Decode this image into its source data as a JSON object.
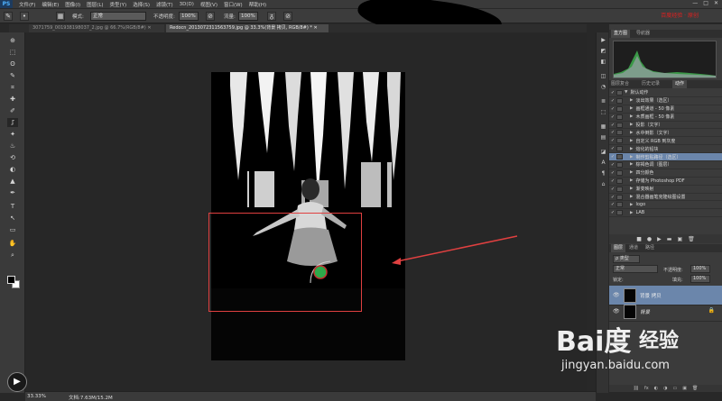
{
  "app": {
    "logo": "PS"
  },
  "menu": [
    "文件(F)",
    "编辑(E)",
    "图像(I)",
    "图层(L)",
    "类型(Y)",
    "选择(S)",
    "滤镜(T)",
    "3D(D)",
    "视图(V)",
    "窗口(W)",
    "帮助(H)"
  ],
  "window_controls": [
    "—",
    "□",
    "✕"
  ],
  "options": {
    "mode_label": "模式:",
    "mode_value": "正常",
    "opacity_label": "不透明度:",
    "opacity_value": "100%",
    "flow_label": "流量:",
    "flow_value": "100%",
    "annotation": "百度经验 · 原创"
  },
  "tabs": [
    {
      "label": "3071759_001938198037_2.jpg @ 66.7%(RGB/8#) ✕",
      "active": false
    },
    {
      "label": "Redocn_2013072311563759.jpg @ 33.3%(背景 拷贝, RGB/8#) * ✕",
      "active": true
    }
  ],
  "tools": [
    "⊕",
    "⬚",
    "ʘ",
    "✎",
    "⌗",
    "✚",
    "✐",
    "⎎",
    "✦",
    "♨",
    "⟲",
    "◐",
    "▲",
    "✒",
    "T",
    "↖",
    "▭",
    "✋",
    "⌕"
  ],
  "dock": [
    "▶",
    "◩",
    "◧",
    "◫",
    "◔",
    "≣",
    "⬚",
    "▦",
    "▤",
    "◪",
    "A",
    "¶",
    "⌂"
  ],
  "histogram_panel": {
    "tabs": [
      "直方图",
      "导航器"
    ]
  },
  "actions_panel": {
    "tabs": [
      "图层复合",
      "历史记录",
      "动作"
    ],
    "items": [
      {
        "label": "默认动作",
        "selected": false
      },
      {
        "label": "淡出效果（选区）",
        "selected": false
      },
      {
        "label": "画框通道 - 50 像素",
        "selected": false
      },
      {
        "label": "木质画框 - 50 像素",
        "selected": false
      },
      {
        "label": "投影（文字）",
        "selected": false
      },
      {
        "label": "水中倒影（文字）",
        "selected": false
      },
      {
        "label": "自定义 RGB 到灰度",
        "selected": false
      },
      {
        "label": "熔化的铅块",
        "selected": false
      },
      {
        "label": "制作剪贴路径（选区）",
        "selected": true
      },
      {
        "label": "棕褐色调（图层）",
        "selected": false
      },
      {
        "label": "四分颜色",
        "selected": false
      },
      {
        "label": "存储为 Photoshop PDF",
        "selected": false
      },
      {
        "label": "渐变映射",
        "selected": false
      },
      {
        "label": "混合器画笔克隆绘图设置",
        "selected": false
      },
      {
        "label": "logo",
        "selected": false
      },
      {
        "label": "LAB",
        "selected": false
      }
    ],
    "footer": [
      "■",
      "●",
      "▶",
      "▬",
      "▣",
      "🗑"
    ]
  },
  "layers_panel": {
    "tabs": [
      "图层",
      "通道",
      "路径"
    ],
    "kind_value": "ρ 类型",
    "blend_value": "正常",
    "opacity_label": "不透明度:",
    "opacity_value": "100%",
    "lock_label": "锁定:",
    "fill_label": "填充:",
    "fill_value": "100%",
    "layers": [
      {
        "name": "背景 拷贝",
        "selected": true,
        "lock": ""
      },
      {
        "name": "背景",
        "selected": false,
        "lock": "🔒"
      }
    ],
    "footer": [
      "⛓",
      "fx",
      "◐",
      "◑",
      "▭",
      "▣",
      "🗑"
    ]
  },
  "status": {
    "zoom": "33.33%",
    "doc": "文档:7.63M/15.2M"
  },
  "watermark": {
    "logo": "Bai度",
    "jingyan": "经验",
    "url": "jingyan.baidu.com"
  },
  "colors": {
    "selection_rect": "#e04040",
    "brush_cursor": "#2ea84a",
    "selected_row": "#6b86ab"
  }
}
